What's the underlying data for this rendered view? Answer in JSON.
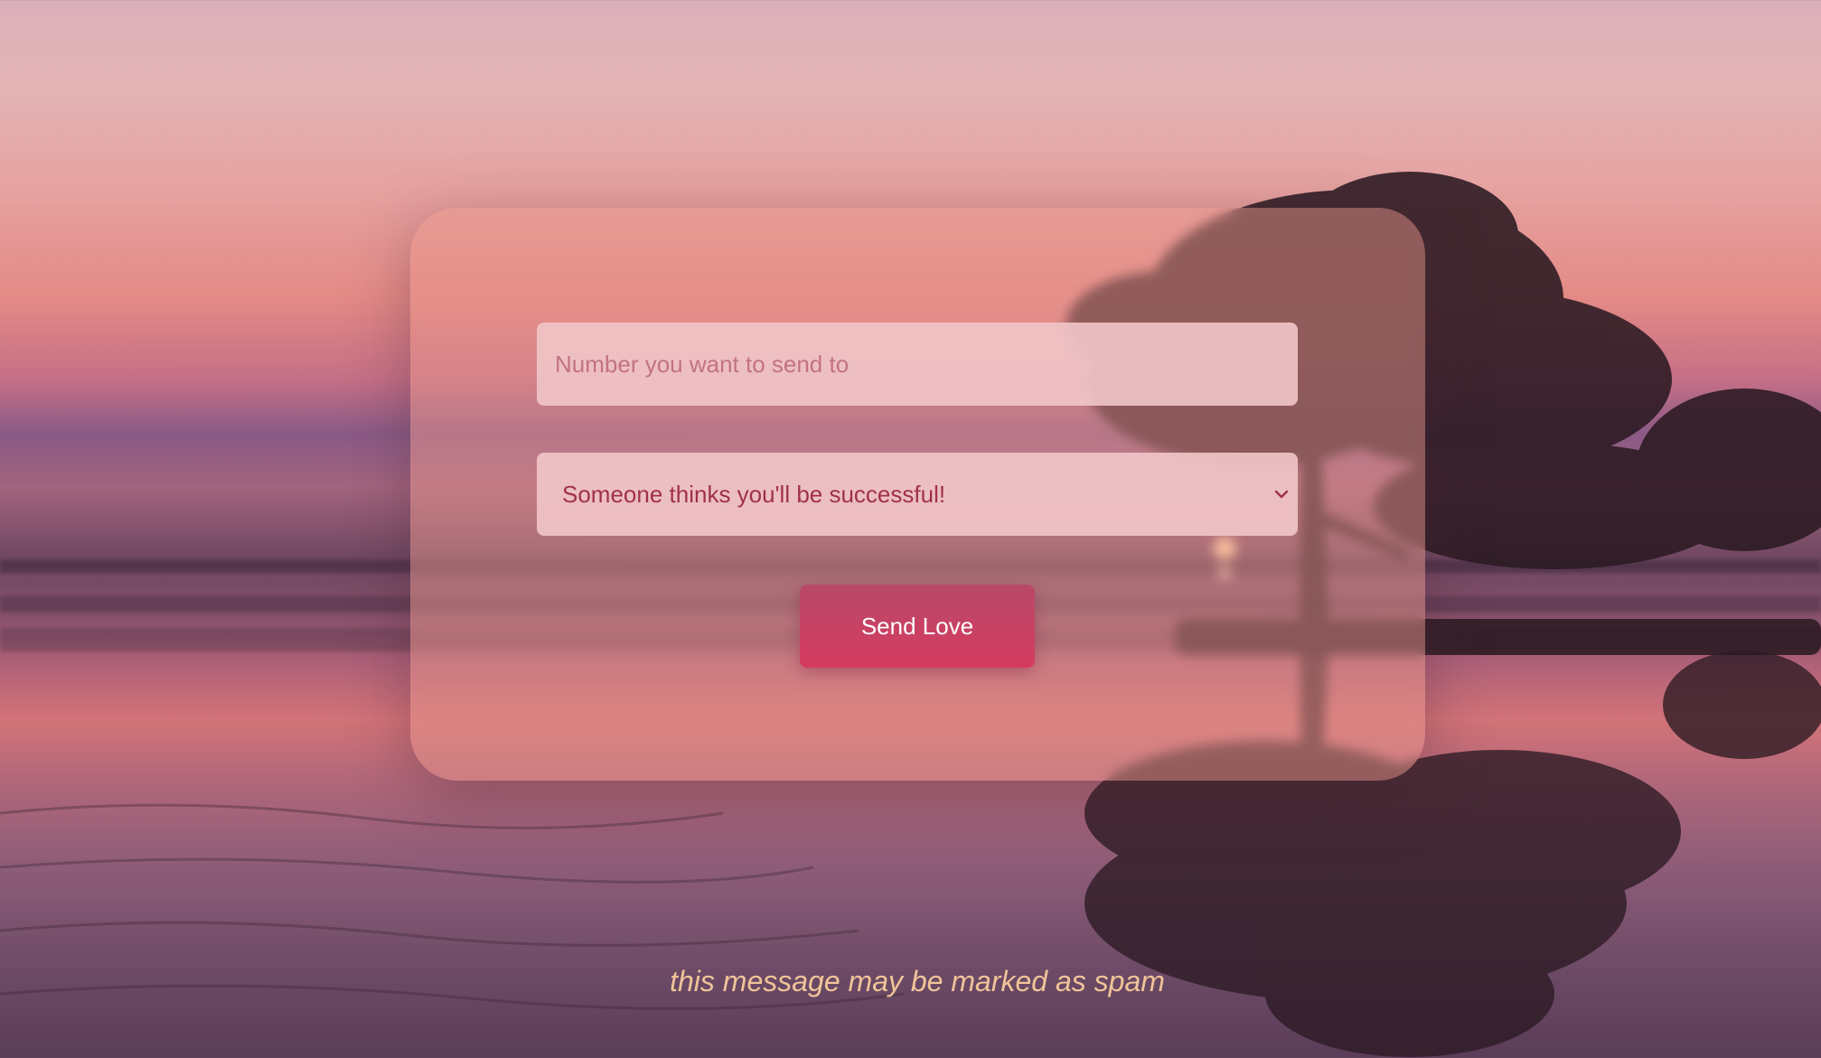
{
  "form": {
    "phone_placeholder": "Number you want to send to",
    "phone_value": "",
    "message_selected": "Someone thinks you'll be successful!",
    "send_label": "Send Love"
  },
  "footer": {
    "disclaimer": "this message may be marked as spam"
  },
  "icons": {
    "select_arrow": "chevron-down-icon"
  },
  "colors": {
    "button": "#d63a5f",
    "disclaimer_text": "#f0c498",
    "select_text": "#a0304c"
  }
}
